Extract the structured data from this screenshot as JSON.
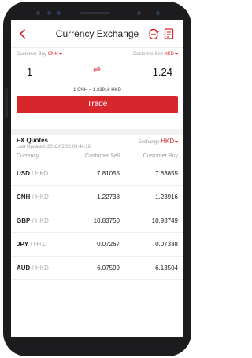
{
  "header": {
    "title": "Currency Exchange"
  },
  "converter": {
    "buy_label": "Customer Buy",
    "buy_currency": "CNH",
    "buy_amount": "1",
    "sell_label": "Customer Sell",
    "sell_currency": "HKD",
    "sell_amount": "1.24",
    "rate_text": "1 CNH = 1.23916 HKD",
    "trade_label": "Trade"
  },
  "fx": {
    "title": "FX Quotes",
    "exchange_label": "Exchange",
    "exchange_currency": "HKD",
    "last_updated": "Last Updated: 2018/02/22 09:44:16",
    "columns": [
      "Currency",
      "Customer Sell",
      "Customer Buy"
    ],
    "rows": [
      {
        "base": "USD",
        "quote": "HKD",
        "sell": "7.81055",
        "buy": "7.83855"
      },
      {
        "base": "CNH",
        "quote": "HKD",
        "sell": "1.22738",
        "buy": "1.23916"
      },
      {
        "base": "GBP",
        "quote": "HKD",
        "sell": "10.83750",
        "buy": "10.93749"
      },
      {
        "base": "JPY",
        "quote": "HKD",
        "sell": "0.07267",
        "buy": "0.07338"
      },
      {
        "base": "AUD",
        "quote": "HKD",
        "sell": "6.07599",
        "buy": "6.13504"
      }
    ]
  },
  "colors": {
    "accent": "#d7262c",
    "phone": "#1c1c1e"
  },
  "icons": [
    "chevron-left-icon",
    "refresh-chat-icon",
    "document-icon",
    "swap-arrows-icon",
    "caret-down-icon"
  ]
}
